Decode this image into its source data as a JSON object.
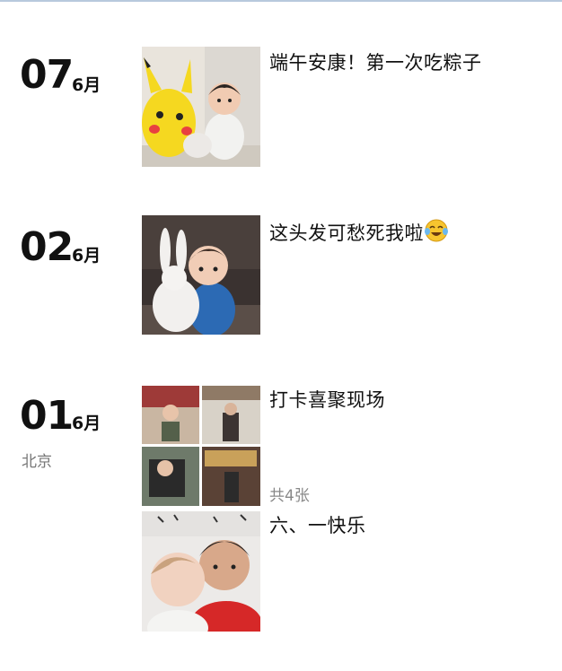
{
  "posts": [
    {
      "day": "07",
      "month": "6月",
      "location": "",
      "caption": "端午安康！第一次吃粽子",
      "photo_icon": "baby-with-pikachu-photo"
    },
    {
      "day": "02",
      "month": "6月",
      "location": "",
      "caption": "这头发可愁死我啦",
      "emoji_icon": "laughing-crying-emoji-icon",
      "photo_icon": "baby-with-plush-bunny-photo"
    },
    {
      "day": "01",
      "month": "6月",
      "location": "北京",
      "caption": "打卡喜聚现场",
      "count": "共4张",
      "photo_icon": "photo-grid-thumbnail"
    },
    {
      "caption": "六、一快乐",
      "photo_icon": "father-and-baby-photo"
    }
  ],
  "colors": {
    "topbar": "#b8c9dd",
    "text": "#111111",
    "muted": "#888888"
  }
}
